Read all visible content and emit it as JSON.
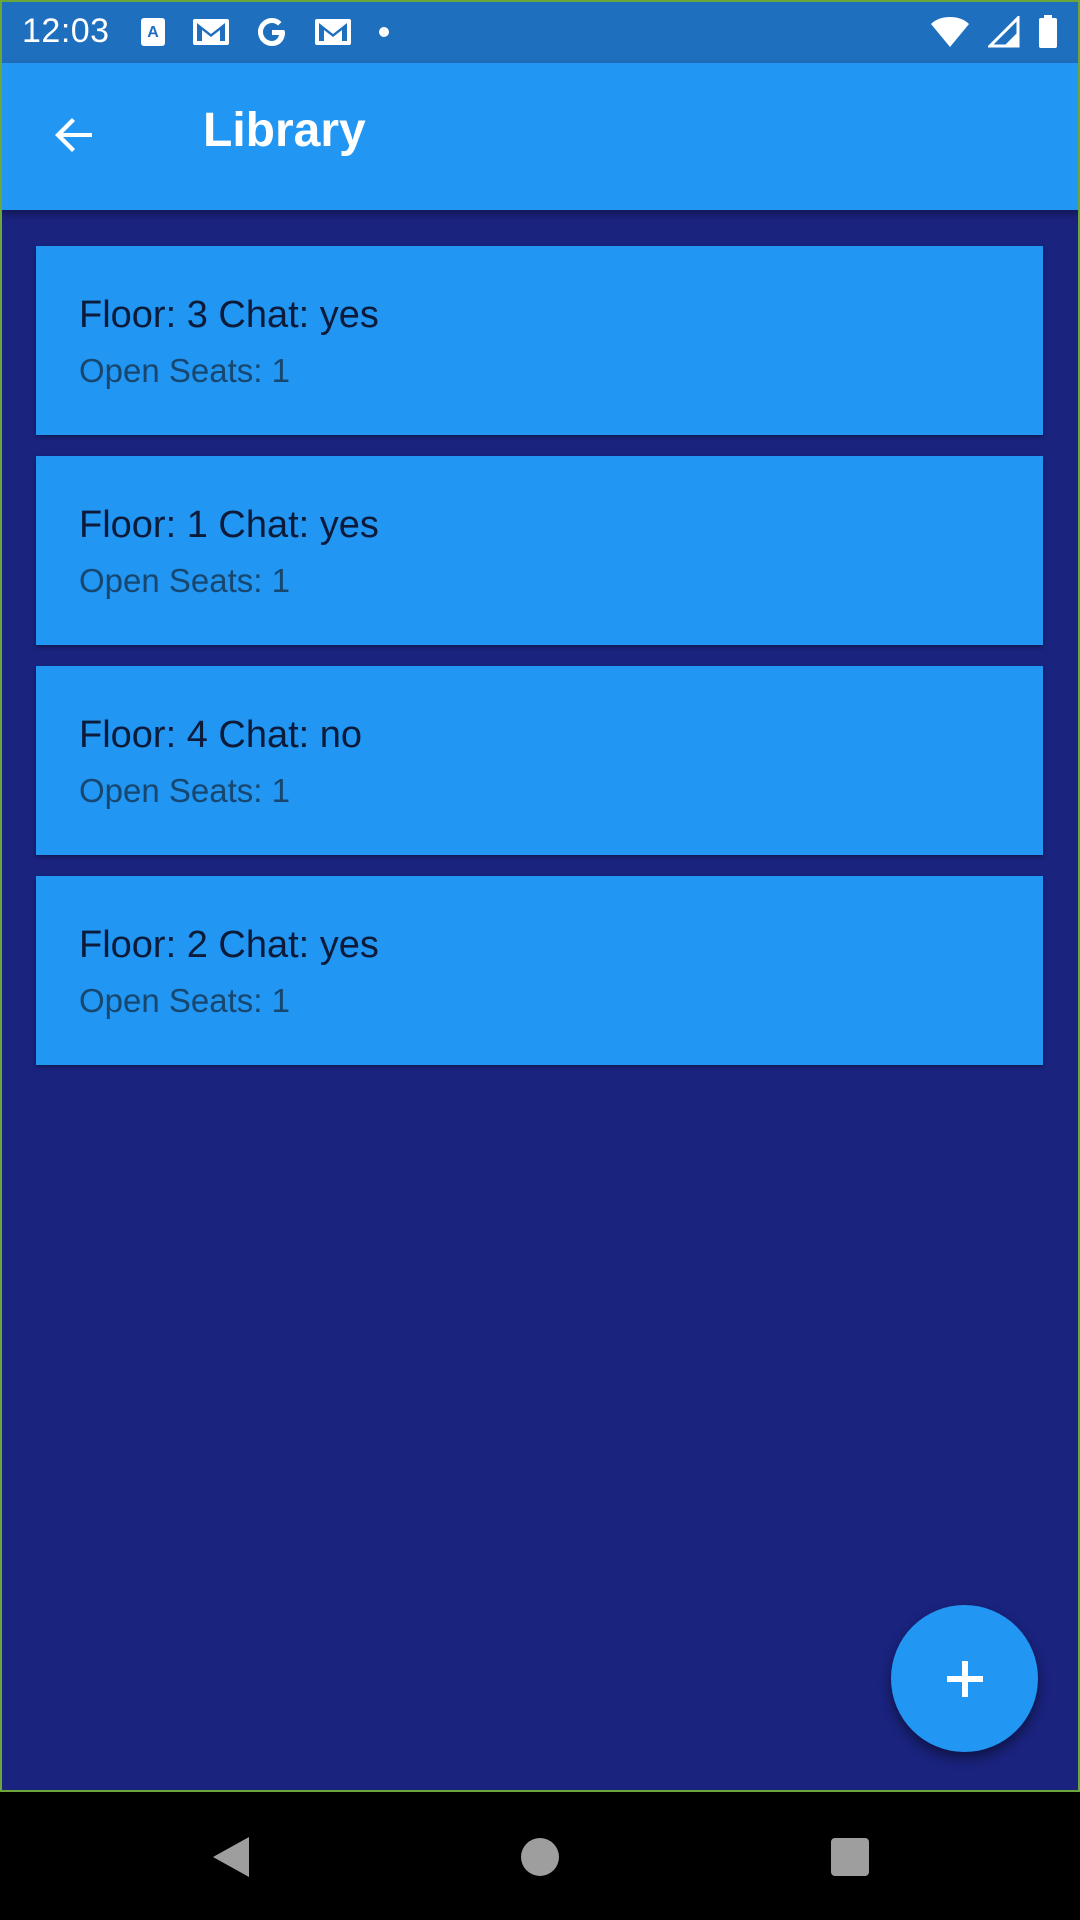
{
  "status_bar": {
    "time": "12:03",
    "notification_icons": [
      "font-a-icon",
      "gmail-icon",
      "google-g-icon",
      "gmail-icon",
      "dot-icon"
    ],
    "system_icons": [
      "wifi-icon",
      "signal-icon",
      "battery-icon"
    ]
  },
  "app_bar": {
    "title": "Library",
    "back_icon": "arrow-left-icon"
  },
  "items": [
    {
      "title": "Floor: 3 Chat: yes",
      "subtitle": "Open Seats: 1"
    },
    {
      "title": "Floor: 1 Chat: yes",
      "subtitle": "Open Seats: 1"
    },
    {
      "title": "Floor: 4 Chat: no",
      "subtitle": "Open Seats: 1"
    },
    {
      "title": "Floor: 2 Chat: yes",
      "subtitle": "Open Seats: 1"
    }
  ],
  "fab": {
    "icon": "plus-icon"
  },
  "nav_bar": {
    "icons": [
      "nav-back-icon",
      "nav-home-icon",
      "nav-recents-icon"
    ]
  },
  "colors": {
    "background": "#1a237e",
    "primary": "#2196f3",
    "status_bar": "#1f6fbf"
  }
}
